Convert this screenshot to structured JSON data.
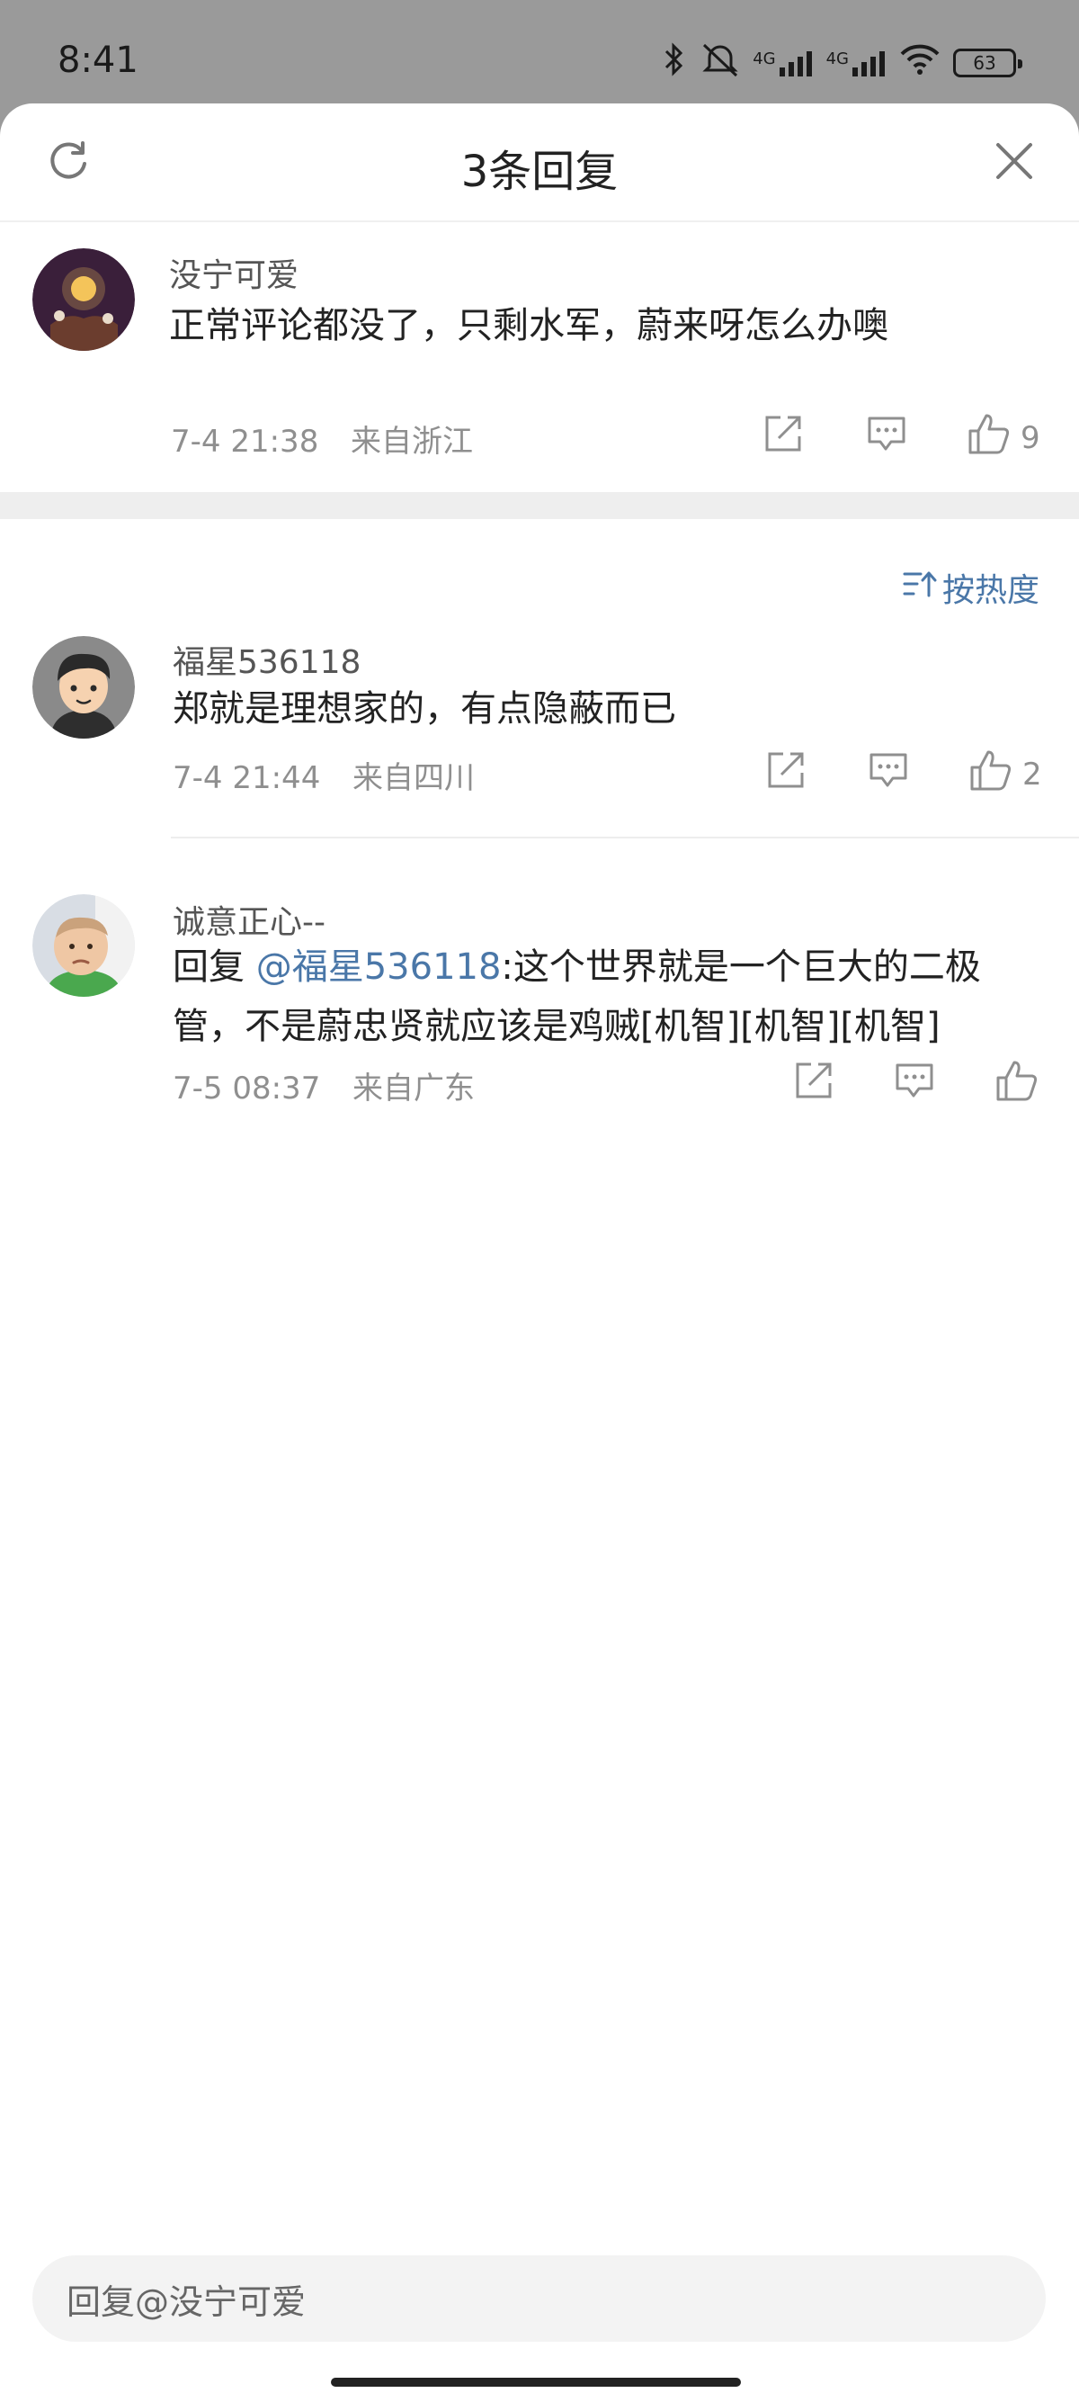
{
  "status_bar": {
    "time": "8:41",
    "net1": "4G",
    "net2": "4G",
    "battery": "63"
  },
  "header": {
    "title": "3条回复"
  },
  "root_comment": {
    "username": "没宁可爱",
    "text": "正常评论都没了，只剩水军，蔚来呀怎么办噢",
    "time": "7-4 21:38",
    "location": "来自浙江",
    "like_count": "9"
  },
  "sort": {
    "label": "按热度"
  },
  "replies": [
    {
      "username": "福星536118",
      "text": "郑就是理想家的，有点隐蔽而已",
      "time": "7-4 21:44",
      "location": "来自四川",
      "like_count": "2"
    },
    {
      "username": "诚意正心--",
      "reply_prefix": "回复 ",
      "mention": "@福星536118",
      "text_line1": ":这个世界就是一个巨大的二极",
      "text_line2": "管，不是蔚忠贤就应该是鸡贼[机智][机智][机智]",
      "time": "7-5 08:37",
      "location": "来自广东"
    }
  ],
  "input": {
    "placeholder": "回复@没宁可爱"
  },
  "colors": {
    "link": "#4a77a8",
    "meta": "#8f8f8f"
  }
}
